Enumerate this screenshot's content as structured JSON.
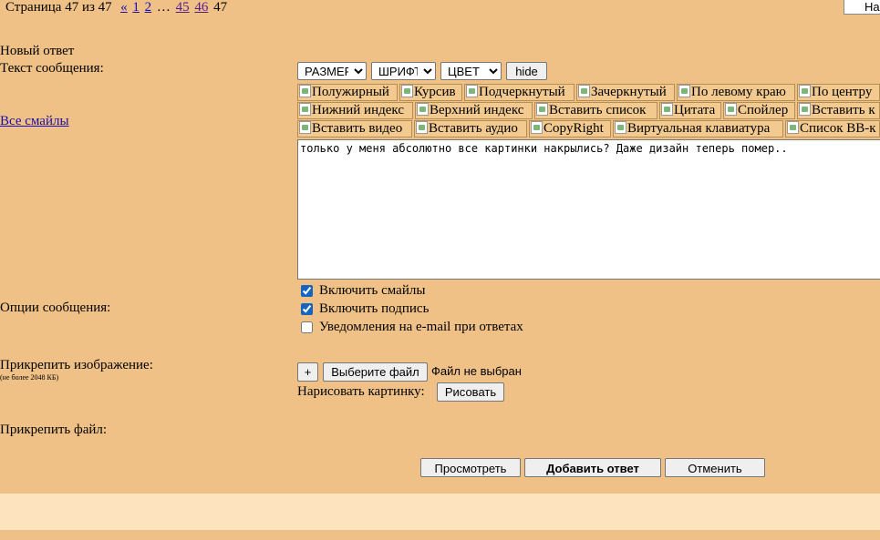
{
  "pager": {
    "prefix": "Страница 47 из 47",
    "prev": "«",
    "page1": "1",
    "page2": "2",
    "ellipsis": "…",
    "page45": "45",
    "page46": "46",
    "current": "47"
  },
  "top_right_button": "На",
  "form": {
    "new_reply": "Новый ответ",
    "message_text_label": "Текст сообщения:",
    "all_smiles": "Все смайлы",
    "size_select": "РАЗМЕР",
    "font_select": "ШРИФТ",
    "color_select": "ЦВЕТ",
    "hide_button": "hide",
    "bbcode_row1": [
      "Полужирный",
      "Курсив",
      "Подчеркнутый",
      "Зачеркнутый",
      "По левому краю",
      "По центру"
    ],
    "bbcode_row2": [
      "Нижний индекс",
      "Верхний индекс",
      "Вставить список",
      "Цитата",
      "Спойлер",
      "Вставить к"
    ],
    "bbcode_row3": [
      "Вставить видео",
      "Вставить аудио",
      "CopyRight",
      "Виртуальная клавиатура",
      "Список BB-к"
    ],
    "message_text": "только у меня абсолютно все картинки накрылись? Даже дизайн теперь помер..",
    "options_label": "Опции сообщения:",
    "opt_smiles": "Включить смайлы",
    "opt_signature": "Включить подпись",
    "opt_email": "Уведомления на e-mail при ответах",
    "attach_image_label": "Прикрепить изображение:",
    "attach_image_note": "(не более 2048 КБ)",
    "plus_button": "+",
    "choose_file_button": "Выберите файл",
    "no_file_text": "Файл не выбран",
    "draw_label": "Нарисовать картинку:",
    "draw_button": "Рисовать",
    "attach_file_label": "Прикрепить файл:",
    "preview_button": "Просмотреть",
    "submit_button": "Добавить ответ",
    "cancel_button": "Отменить"
  },
  "checkbox_state": {
    "smiles": true,
    "signature": true,
    "email": false
  }
}
